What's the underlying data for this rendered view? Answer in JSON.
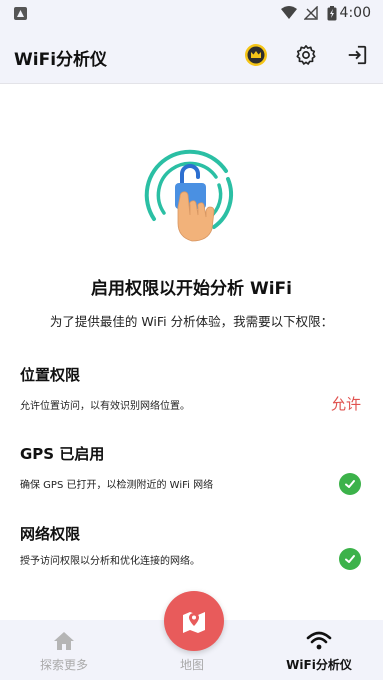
{
  "statusbar": {
    "time": "4:00"
  },
  "appbar": {
    "title": "WiFi分析仪",
    "premium_icon": "crown-badge-icon",
    "settings_icon": "gear-icon",
    "exit_icon": "exit-icon"
  },
  "main": {
    "heading": "启用权限以开始分析 WiFi",
    "subheading": "为了提供最佳的 WiFi 分析体验，我需要以下权限："
  },
  "permissions": [
    {
      "title": "位置权限",
      "desc": "允许位置访问，以有效识别网络位置。",
      "action": "允许",
      "granted": false
    },
    {
      "title": "GPS 已启用",
      "desc": "确保 GPS 已打开，以检测附近的 WiFi 网络",
      "granted": true
    },
    {
      "title": "网络权限",
      "desc": "授予访问权限以分析和优化连接的网络。",
      "granted": true
    }
  ],
  "nav": {
    "items": [
      {
        "label": "探索更多",
        "icon": "home-icon",
        "active": false
      },
      {
        "label": "地图",
        "icon": "map-icon",
        "active": false
      },
      {
        "label": "WiFi分析仪",
        "icon": "wifi-icon",
        "active": true
      }
    ]
  },
  "colors": {
    "accent": "#e0524f",
    "fab": "#e85b5b",
    "granted": "#3cb24a",
    "ring": "#2bbfa4",
    "lock": "#4a90e2"
  }
}
